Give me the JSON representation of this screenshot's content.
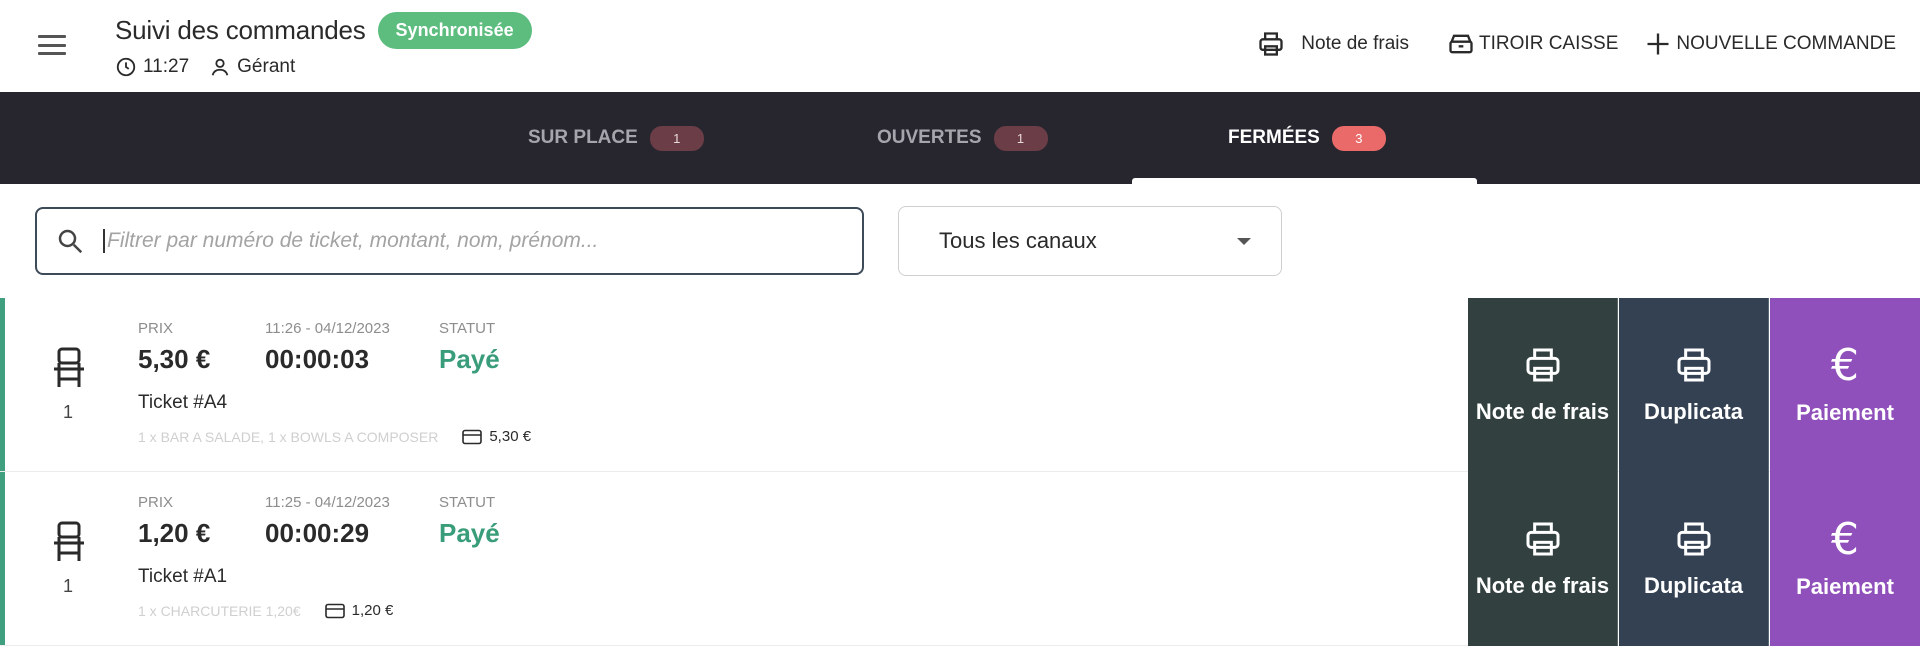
{
  "header": {
    "title": "Suivi des commandes",
    "sync_badge": "Synchronisée",
    "time": "11:27",
    "user_role": "Gérant",
    "actions": {
      "expense_note": "Note de frais",
      "cash_drawer": "TIROIR CAISSE",
      "new_order": "NOUVELLE COMMANDE"
    }
  },
  "tabs": [
    {
      "label": "SUR PLACE",
      "count": "1",
      "active": false
    },
    {
      "label": "OUVERTES",
      "count": "1",
      "active": false
    },
    {
      "label": "FERMÉES",
      "count": "3",
      "active": true
    }
  ],
  "filters": {
    "search_placeholder": "Filtrer par numéro de ticket, montant, nom, prénom...",
    "search_value": "",
    "channel_selected": "Tous les canaux"
  },
  "columns": {
    "price": "PRIX",
    "status": "STATUT"
  },
  "orders": [
    {
      "seat": "1",
      "price": "5,30 €",
      "datetime": "11:26 - 04/12/2023",
      "duration": "00:00:03",
      "status": "Payé",
      "ticket": "Ticket #A4",
      "items": "1 x BAR A SALADE, 1 x BOWLS A COMPOSER",
      "payment_amount": "5,30 €"
    },
    {
      "seat": "1",
      "price": "1,20 €",
      "datetime": "11:25 - 04/12/2023",
      "duration": "00:00:29",
      "status": "Payé",
      "ticket": "Ticket #A1",
      "items": "1 x CHARCUTERIE 1,20€",
      "payment_amount": "1,20 €"
    }
  ],
  "row_actions": {
    "expense_note": "Note de frais",
    "duplicate": "Duplicata",
    "payment": "Paiement",
    "payment_symbol": "€"
  },
  "colors": {
    "tabs_bg": "#27262f",
    "sync_green": "#5cbd7f",
    "status_green": "#3a9d79",
    "badge_active": "#ea6a6a",
    "note_btn": "#324140",
    "dup_btn": "#334153",
    "pay_btn": "#9050bb"
  },
  "icons": [
    "menu-icon",
    "clock-icon",
    "user-icon",
    "printer-icon",
    "cash-drawer-icon",
    "plus-icon",
    "search-icon",
    "chevron-down-icon",
    "chair-icon",
    "card-icon",
    "euro-icon"
  ]
}
